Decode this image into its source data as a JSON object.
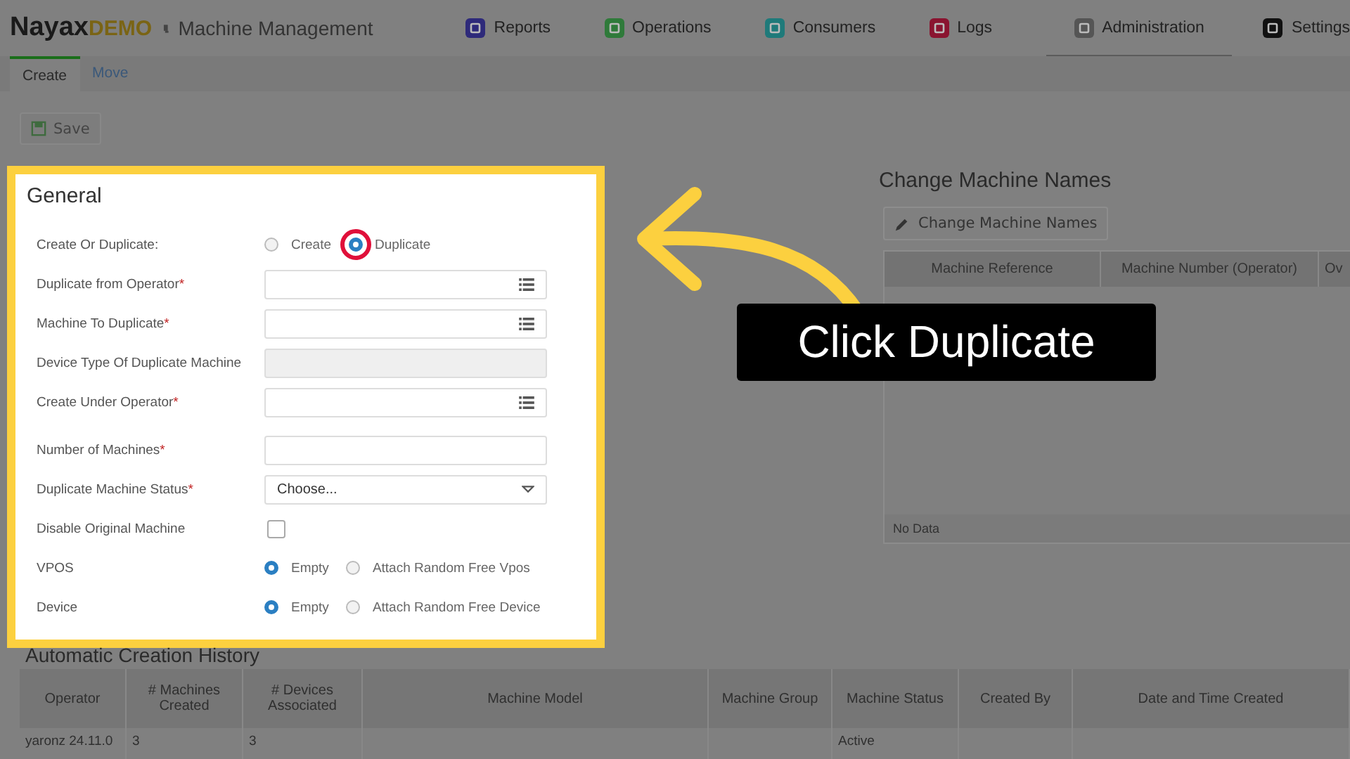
{
  "header": {
    "logo": "Nayax",
    "logo_badge": "DEMO",
    "page_title": "Machine Management"
  },
  "nav": [
    {
      "label": "Reports",
      "color": "#2e2a7a",
      "selected": false
    },
    {
      "label": "Operations",
      "color": "#2f7a3a",
      "selected": false
    },
    {
      "label": "Consumers",
      "color": "#1f7a7a",
      "selected": false
    },
    {
      "label": "Logs",
      "color": "#8a1430",
      "selected": false
    },
    {
      "label": "Administration",
      "color": "#555555",
      "selected": true
    },
    {
      "label": "Settings",
      "color": "#111111",
      "selected": false
    }
  ],
  "subtabs": [
    {
      "label": "Create",
      "selected": true
    },
    {
      "label": "Move",
      "selected": false
    }
  ],
  "save_button": "Save",
  "general": {
    "title": "General",
    "fields": [
      {
        "kind": "radio",
        "label": "Create Or Duplicate:",
        "options": [
          {
            "label": "Create",
            "selected": false
          },
          {
            "label": "Duplicate",
            "selected": true,
            "highlighted": true
          }
        ]
      },
      {
        "kind": "lookup",
        "label": "Duplicate from Operator",
        "required_mark": "*"
      },
      {
        "kind": "lookup",
        "label": "Machine To Duplicate",
        "required_mark": "*"
      },
      {
        "kind": "readonly",
        "label": "Device Type Of Duplicate Machine"
      },
      {
        "kind": "lookup",
        "label": "Create Under Operator",
        "required_mark": "*"
      },
      {
        "kind": "text",
        "label": "Number of Machines",
        "required_mark": "*"
      },
      {
        "kind": "select",
        "label": "Duplicate Machine Status",
        "required_mark": "*",
        "value": "Choose..."
      },
      {
        "kind": "checkbox",
        "label": "Disable Original Machine",
        "checked": false
      },
      {
        "kind": "radio",
        "label": "VPOS",
        "options": [
          {
            "label": "Empty",
            "selected": true
          },
          {
            "label": "Attach Random Free Vpos",
            "selected": false
          }
        ]
      },
      {
        "kind": "radio",
        "label": "Device",
        "options": [
          {
            "label": "Empty",
            "selected": true
          },
          {
            "label": "Attach Random Free Device",
            "selected": false
          }
        ]
      }
    ]
  },
  "change_names": {
    "title": "Change Machine Names",
    "button": "Change Machine Names",
    "columns": [
      "Machine Reference",
      "Machine Number (Operator)",
      "Ov"
    ],
    "footer": "No Data"
  },
  "callout": "Click Duplicate",
  "history": {
    "title": "Automatic Creation History",
    "columns": [
      "Operator",
      "# Machines Created",
      "# Devices Associated",
      "Machine Model",
      "Machine Group",
      "Machine Status",
      "Created By",
      "Date and Time Created"
    ],
    "rows": [
      [
        "yaronz 24.11.0",
        "3",
        "3",
        "",
        "",
        "Active",
        "",
        ""
      ]
    ]
  }
}
